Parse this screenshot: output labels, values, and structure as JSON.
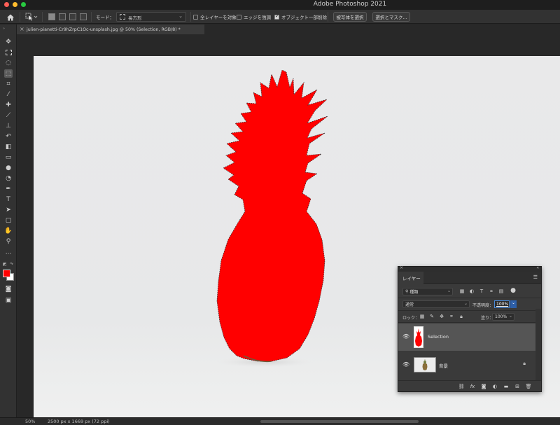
{
  "window": {
    "title": "Adobe Photoshop 2021",
    "traffic_colors": [
      "#ff5f57",
      "#febc2e",
      "#28c840"
    ]
  },
  "options_bar": {
    "mode_label": "モード：",
    "mode_value": "長方形",
    "sample_all_layers": "全レイヤーを対象",
    "hard_edge": "エッジを強調",
    "object_subtract": "オブジェクト一部削除",
    "select_subject": "被写体を選択",
    "select_and_mask": "選択とマスク..."
  },
  "document_tab": {
    "title": "julien-pianetti-Cr9hZrpC1Oc-unsplash.jpg @ 50% (Selection, RGB/8) *",
    "close": "×"
  },
  "toolbar": {
    "tools": [
      "move-icon",
      "marquee-icon",
      "lasso-icon",
      "object-select-icon",
      "crop-icon",
      "eyedropper-icon",
      "healing-icon",
      "brush-icon",
      "stamp-icon",
      "history-brush-icon",
      "eraser-icon",
      "gradient-icon",
      "blur-icon",
      "dodge-icon",
      "pen-icon",
      "type-icon",
      "path-select-icon",
      "shape-icon",
      "hand-icon",
      "zoom-icon",
      "more-icon"
    ],
    "foreground_color": "#ff0000",
    "background_color": "#ffffff"
  },
  "status_bar": {
    "zoom": "50%",
    "doc_size": "2500 px x 1669 px (72 ppi)"
  },
  "layers_panel": {
    "tab_label": "レイヤー",
    "filter_kind": "種類",
    "blend_mode": "通常",
    "opacity_label": "不透明度：",
    "opacity_value": "100%",
    "lock_label": "ロック：",
    "fill_label": "塗り：",
    "fill_value": "100%",
    "layers": [
      {
        "name": "Selection",
        "selected": true,
        "visible": true,
        "locked": false
      },
      {
        "name": "背景",
        "selected": false,
        "visible": true,
        "locked": true
      }
    ]
  },
  "canvas": {
    "subject_color": "#ff0000"
  }
}
